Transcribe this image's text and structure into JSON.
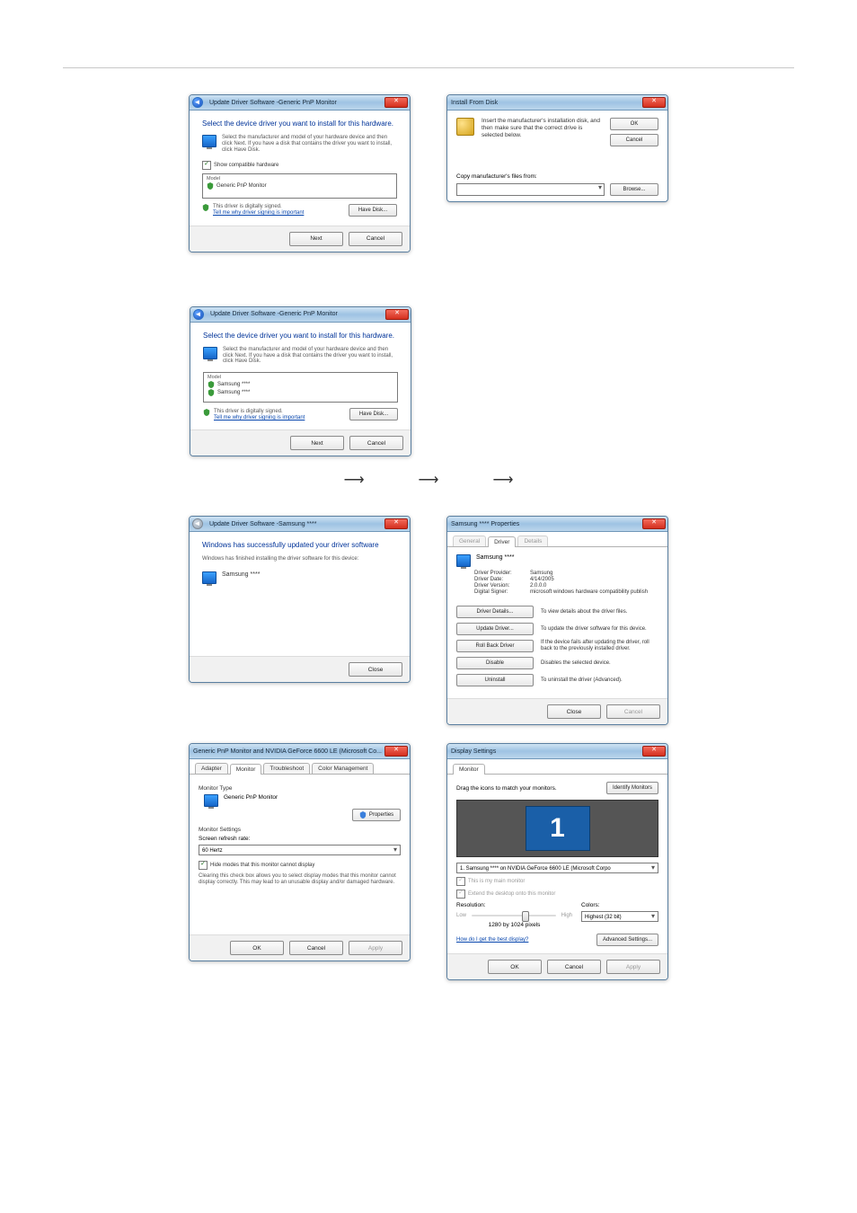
{
  "row1": {
    "wiz1": {
      "title_prefix": "Update Driver Software - ",
      "title_device": "Generic PnP Monitor",
      "heading": "Select the device driver you want to install for this hardware.",
      "instr": "Select the manufacturer and model of your hardware device and then click Next. If you have a disk that contains the driver you want to install, click Have Disk.",
      "show_compat": "Show compatible hardware",
      "model_label": "Model",
      "model_item": "Generic PnP Monitor",
      "signed": "This driver is digitally signed.",
      "signed_link": "Tell me why driver signing is important",
      "have_disk": "Have Disk...",
      "next": "Next",
      "cancel": "Cancel"
    },
    "ifd": {
      "title": "Install From Disk",
      "text": "Insert the manufacturer's installation disk, and then make sure that the correct drive is selected below.",
      "ok": "OK",
      "cancel": "Cancel",
      "copy_label": "Copy manufacturer's files from:",
      "browse": "Browse..."
    }
  },
  "row2": {
    "wiz2": {
      "title_prefix": "Update Driver Software - ",
      "title_device": "Generic PnP Monitor",
      "heading": "Select the device driver you want to install for this hardware.",
      "instr": "Select the manufacturer and model of your hardware device and then click Next. If you have a disk that contains the driver you want to install, click Have Disk.",
      "model_label": "Model",
      "model_item1": "Samsung ****",
      "model_item2": "Samsung ****",
      "signed": "This driver is digitally signed.",
      "signed_link": "Tell me why driver signing is important",
      "have_disk": "Have Disk...",
      "next": "Next",
      "cancel": "Cancel"
    }
  },
  "row3": {
    "wiz3": {
      "title_prefix": "Update Driver Software - ",
      "title_device": "Samsung ****",
      "heading": "Windows has successfully updated your driver software",
      "sub": "Windows has finished installing the driver software for this device:",
      "device": "Samsung ****",
      "close": "Close"
    },
    "prop": {
      "title": "Samsung **** Properties",
      "tab_general": "General",
      "tab_driver": "Driver",
      "tab_details": "Details",
      "device": "Samsung ****",
      "kv": {
        "provider_k": "Driver Provider:",
        "provider_v": "Samsung",
        "date_k": "Driver Date:",
        "date_v": "4/14/2005",
        "version_k": "Driver Version:",
        "version_v": "2.0.0.0",
        "signer_k": "Digital Signer:",
        "signer_v": "microsoft windows hardware compatibility publish"
      },
      "actions": {
        "details_btn": "Driver Details...",
        "details_desc": "To view details about the driver files.",
        "update_btn": "Update Driver...",
        "update_desc": "To update the driver software for this device.",
        "rollback_btn": "Roll Back Driver",
        "rollback_desc": "If the device fails after updating the driver, roll back to the previously installed driver.",
        "disable_btn": "Disable",
        "disable_desc": "Disables the selected device.",
        "uninstall_btn": "Uninstall",
        "uninstall_desc": "To uninstall the driver (Advanced)."
      },
      "close": "Close",
      "cancel": "Cancel"
    }
  },
  "row4": {
    "monprop": {
      "title": "Generic PnP Monitor and NVIDIA GeForce 6600 LE (Microsoft Co...",
      "tab_adapter": "Adapter",
      "tab_monitor": "Monitor",
      "tab_trouble": "Troubleshoot",
      "tab_colormgmt": "Color Management",
      "monitor_type": "Monitor Type",
      "monitor_name": "Generic PnP Monitor",
      "properties": "Properties",
      "monitor_settings": "Monitor Settings",
      "refresh_label": "Screen refresh rate:",
      "refresh_value": "60 Hertz",
      "hide_modes": "Hide modes that this monitor cannot display",
      "hide_desc": "Clearing this check box allows you to select display modes that this monitor cannot display correctly. This may lead to an unusable display and/or damaged hardware.",
      "ok": "OK",
      "cancel": "Cancel",
      "apply": "Apply"
    },
    "ds": {
      "title": "Display Settings",
      "tab_monitor": "Monitor",
      "drag_text": "Drag the icons to match your monitors.",
      "identify": "Identify Monitors",
      "monitor_num": "1",
      "select_value": "1. Samsung **** on NVIDIA GeForce 6600 LE (Microsoft Corpo",
      "main_chk": "This is my main monitor",
      "extend_chk": "Extend the desktop onto this monitor",
      "res_label": "Resolution:",
      "low": "Low",
      "high": "High",
      "res_value": "1280 by 1024 pixels",
      "colors_label": "Colors:",
      "colors_value": "Highest (32 bit)",
      "help_link": "How do I get the best display?",
      "advanced": "Advanced Settings...",
      "ok": "OK",
      "cancel": "Cancel",
      "apply": "Apply"
    }
  }
}
